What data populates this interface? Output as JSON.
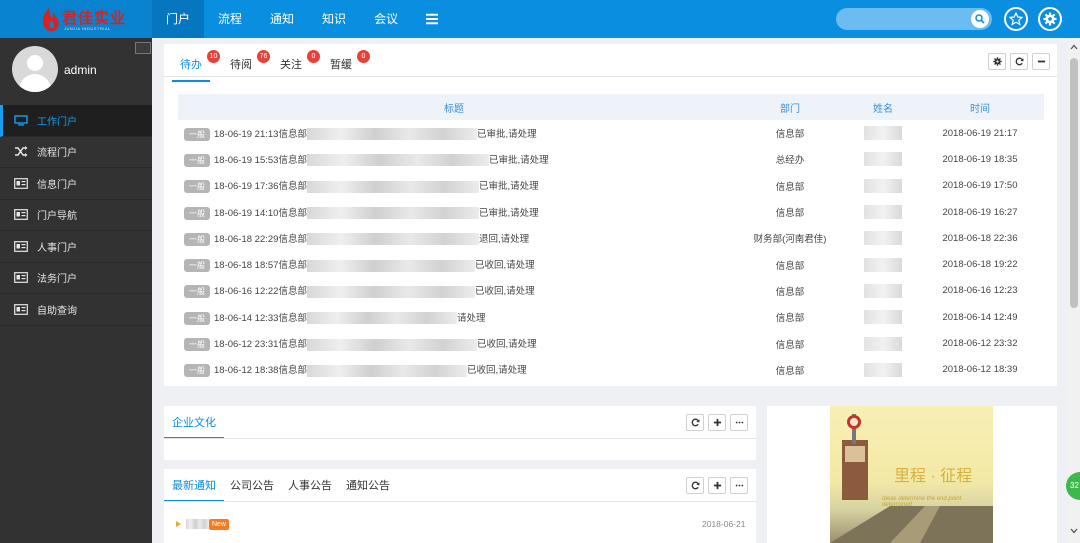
{
  "app": {
    "logo_text": "君佳实业",
    "logo_sub": "JUNJIA INDUSTRIAL",
    "colors": {
      "topbar": "#0a8ee0",
      "sidebar": "#323232",
      "accent": "#0a8ee0",
      "badge": "#e8413c"
    }
  },
  "nav": {
    "items": [
      {
        "label": "门户",
        "active": true
      },
      {
        "label": "流程"
      },
      {
        "label": "通知"
      },
      {
        "label": "知识"
      },
      {
        "label": "会议"
      }
    ],
    "menu_icon": "hamburger-icon"
  },
  "search": {
    "placeholder": ""
  },
  "user": {
    "name": "admin"
  },
  "sidebar": {
    "items": [
      {
        "label": "工作门户",
        "icon": "monitor-icon",
        "active": true
      },
      {
        "label": "流程门户",
        "icon": "shuffle-icon"
      },
      {
        "label": "信息门户",
        "icon": "card-icon"
      },
      {
        "label": "门户导航",
        "icon": "card-icon"
      },
      {
        "label": "人事门户",
        "icon": "card-icon"
      },
      {
        "label": "法务门户",
        "icon": "card-icon"
      },
      {
        "label": "自助查询",
        "icon": "card-icon"
      }
    ]
  },
  "tasks": {
    "tabs": [
      {
        "label": "待办",
        "badge": "10",
        "active": true
      },
      {
        "label": "待阅",
        "badge": "76"
      },
      {
        "label": "关注",
        "badge": "0"
      },
      {
        "label": "暂缓",
        "badge": "0"
      }
    ],
    "columns": {
      "title": "标题",
      "dept": "部门",
      "name": "姓名",
      "time": "时间"
    },
    "rows": [
      {
        "tag": "一般",
        "prefix": "18-06-19 21:13信息部",
        "suffix": "已审批,请处理",
        "dept": "信息部",
        "time": "2018-06-19 21:17"
      },
      {
        "tag": "一般",
        "prefix": "18-06-19 15:53信息部",
        "suffix": "已审批,请处理",
        "dept": "总经办",
        "time": "2018-06-19 18:35"
      },
      {
        "tag": "一般",
        "prefix": "18-06-19 17:36信息部",
        "suffix": "已审批,请处理",
        "dept": "信息部",
        "time": "2018-06-19 17:50"
      },
      {
        "tag": "一般",
        "prefix": "18-06-19 14:10信息部",
        "suffix": "已审批,请处理",
        "dept": "信息部",
        "time": "2018-06-19 16:27"
      },
      {
        "tag": "一般",
        "prefix": "18-06-18 22:29信息部",
        "suffix": "退回,请处理",
        "dept": "财务部(河南君佳)",
        "time": "2018-06-18 22:36"
      },
      {
        "tag": "一般",
        "prefix": "18-06-18 18:57信息部",
        "suffix": "已收回,请处理",
        "dept": "信息部",
        "time": "2018-06-18 19:22"
      },
      {
        "tag": "一般",
        "prefix": "18-06-16 12:22信息部",
        "suffix": "已收回,请处理",
        "dept": "信息部",
        "time": "2018-06-16 12:23"
      },
      {
        "tag": "一般",
        "prefix": "18-06-14 12:33信息部",
        "suffix": "请处理",
        "dept": "信息部",
        "time": "2018-06-14 12:49"
      },
      {
        "tag": "一般",
        "prefix": "18-06-12 23:31信息部",
        "suffix": "已收回,请处理",
        "dept": "信息部",
        "time": "2018-06-12 23:32"
      },
      {
        "tag": "一般",
        "prefix": "18-06-12 18:38信息部",
        "suffix": "已收回,请处理",
        "dept": "信息部",
        "time": "2018-06-12 18:39"
      }
    ]
  },
  "culture": {
    "title": "企业文化"
  },
  "notices": {
    "tabs": [
      {
        "label": "最新通知",
        "active": true
      },
      {
        "label": "公司公告"
      },
      {
        "label": "人事公告"
      },
      {
        "label": "通知公告"
      }
    ],
    "first": {
      "new_label": "New",
      "date": "2018-06-21"
    }
  },
  "poster": {
    "title": "里程 · 征程",
    "subtitle": "Ideas determine the end point determined"
  },
  "float_button": {
    "label": "32"
  }
}
